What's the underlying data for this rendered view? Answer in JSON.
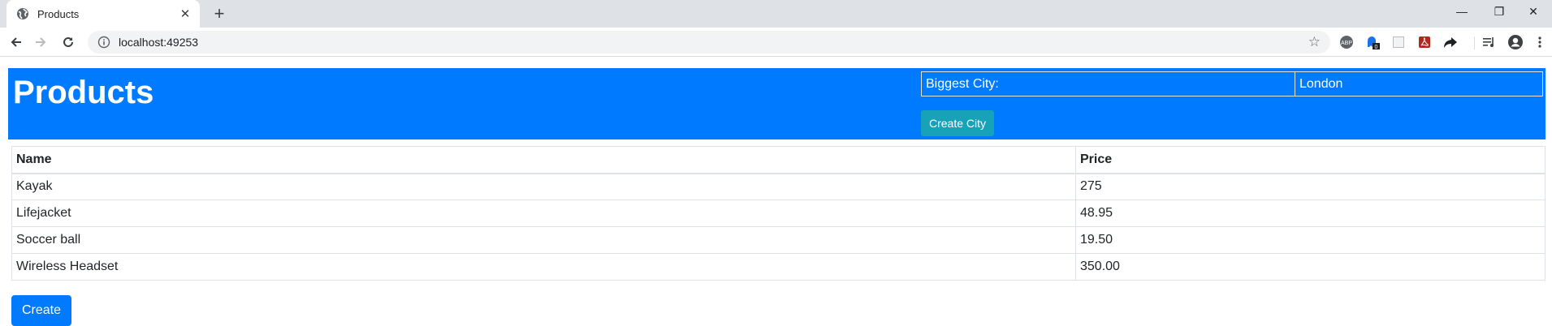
{
  "browser": {
    "tab": {
      "title": "Products",
      "favicon": "globe-icon",
      "close_glyph": "✕"
    },
    "new_tab_glyph": "+",
    "window_controls": {
      "minimize": "—",
      "restore": "❐",
      "close": "✕"
    },
    "address_bar": {
      "url": "localhost:49253"
    },
    "extensions": [
      "extension-badge-icon",
      "extension-ghost-icon",
      "extension-square-icon",
      "pdf-icon",
      "share-arrow-icon",
      "media-playlist-icon",
      "profile-icon",
      "menu-kebab-icon"
    ],
    "ghost_badge_count": "0"
  },
  "page": {
    "title": "Products",
    "city_panel": {
      "label": "Biggest City:",
      "value": "London",
      "create_button": "Create City"
    },
    "products_table": {
      "columns": [
        "Name",
        "Price"
      ],
      "rows": [
        {
          "name": "Kayak",
          "price": "275"
        },
        {
          "name": "Lifejacket",
          "price": "48.95"
        },
        {
          "name": "Soccer ball",
          "price": "19.50"
        },
        {
          "name": "Wireless Headset",
          "price": "350.00"
        }
      ]
    },
    "create_button": "Create"
  },
  "colors": {
    "primary": "#007bff",
    "info": "#17a2b8",
    "border": "#dee2e6",
    "chrome_tabstrip": "#dee1e6"
  }
}
